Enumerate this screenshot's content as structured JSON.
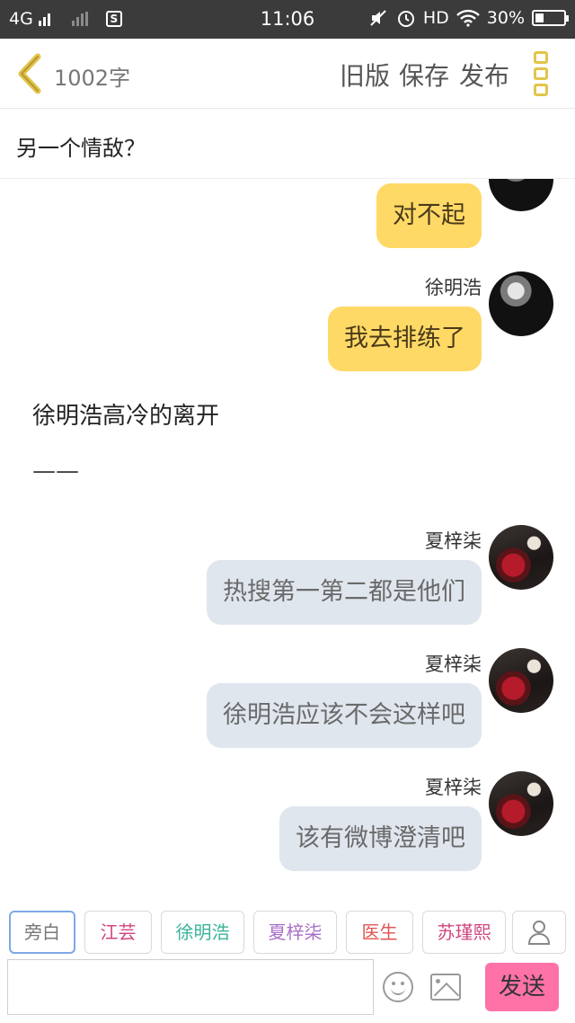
{
  "status_bar": {
    "network": "4G",
    "time": "11:06",
    "hd": "HD",
    "battery": "30%",
    "battery_level": 0.3
  },
  "header": {
    "word_count": "1002字",
    "old_version": "旧版",
    "save": "保存",
    "publish": "发布"
  },
  "title": "另一个情敌？",
  "messages": [
    {
      "type": "bubble",
      "text": "对不起",
      "style": "yellow"
    },
    {
      "type": "bubble",
      "sender": "徐明浩",
      "text": "我去排练了",
      "style": "yellow"
    },
    {
      "type": "narration",
      "text": "徐明浩高冷的离开"
    },
    {
      "type": "narration",
      "text": "——"
    },
    {
      "type": "bubble",
      "sender": "夏梓柒",
      "text": "热搜第一第二都是他们",
      "style": "gray"
    },
    {
      "type": "bubble",
      "sender": "夏梓柒",
      "text": "徐明浩应该不会这样吧",
      "style": "gray"
    },
    {
      "type": "bubble",
      "sender": "夏梓柒",
      "text": "该有微博澄清吧",
      "style": "gray"
    }
  ],
  "roles": [
    {
      "label": "旁白",
      "color": "#777777",
      "active": true
    },
    {
      "label": "江芸",
      "color": "#d0457e"
    },
    {
      "label": "徐明浩",
      "color": "#3bb39a"
    },
    {
      "label": "夏梓柒",
      "color": "#a86fc7"
    },
    {
      "label": "医生",
      "color": "#e05555"
    },
    {
      "label": "苏瑾熙",
      "color": "#d0457e"
    }
  ],
  "input": {
    "value": "",
    "placeholder": "",
    "send": "发送"
  },
  "colors": {
    "accent_yellow": "#ffd966",
    "bubble_gray": "#dfe6ee",
    "send_pink": "#ff72a8"
  }
}
